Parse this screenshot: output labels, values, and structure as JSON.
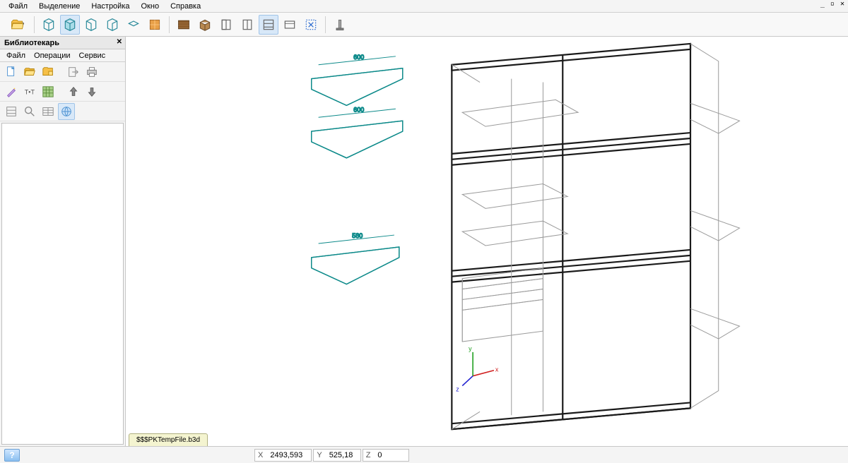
{
  "menu": {
    "items": [
      "Файл",
      "Выделение",
      "Настройка",
      "Окно",
      "Справка"
    ]
  },
  "window_controls": "_ ▫ ✕",
  "sidepanel": {
    "title": "Библиотекарь",
    "menu": [
      "Файл",
      "Операции",
      "Сервис"
    ]
  },
  "filetab": "$$$PKTempFile.b3d",
  "status": {
    "x_label": "X",
    "x_val": "2493,593",
    "y_label": "Y",
    "y_val": "525,18",
    "z_label": "Z",
    "z_val": "0"
  },
  "dimensions": {
    "shelf1": "600",
    "shelf2": "600",
    "shelf3": "580"
  },
  "axis": {
    "x": "x",
    "y": "y",
    "z": "z"
  },
  "colors": {
    "accent_teal": "#0d8a8a",
    "axis_x": "#d02020",
    "axis_y": "#20a020",
    "axis_z": "#2020d0"
  }
}
